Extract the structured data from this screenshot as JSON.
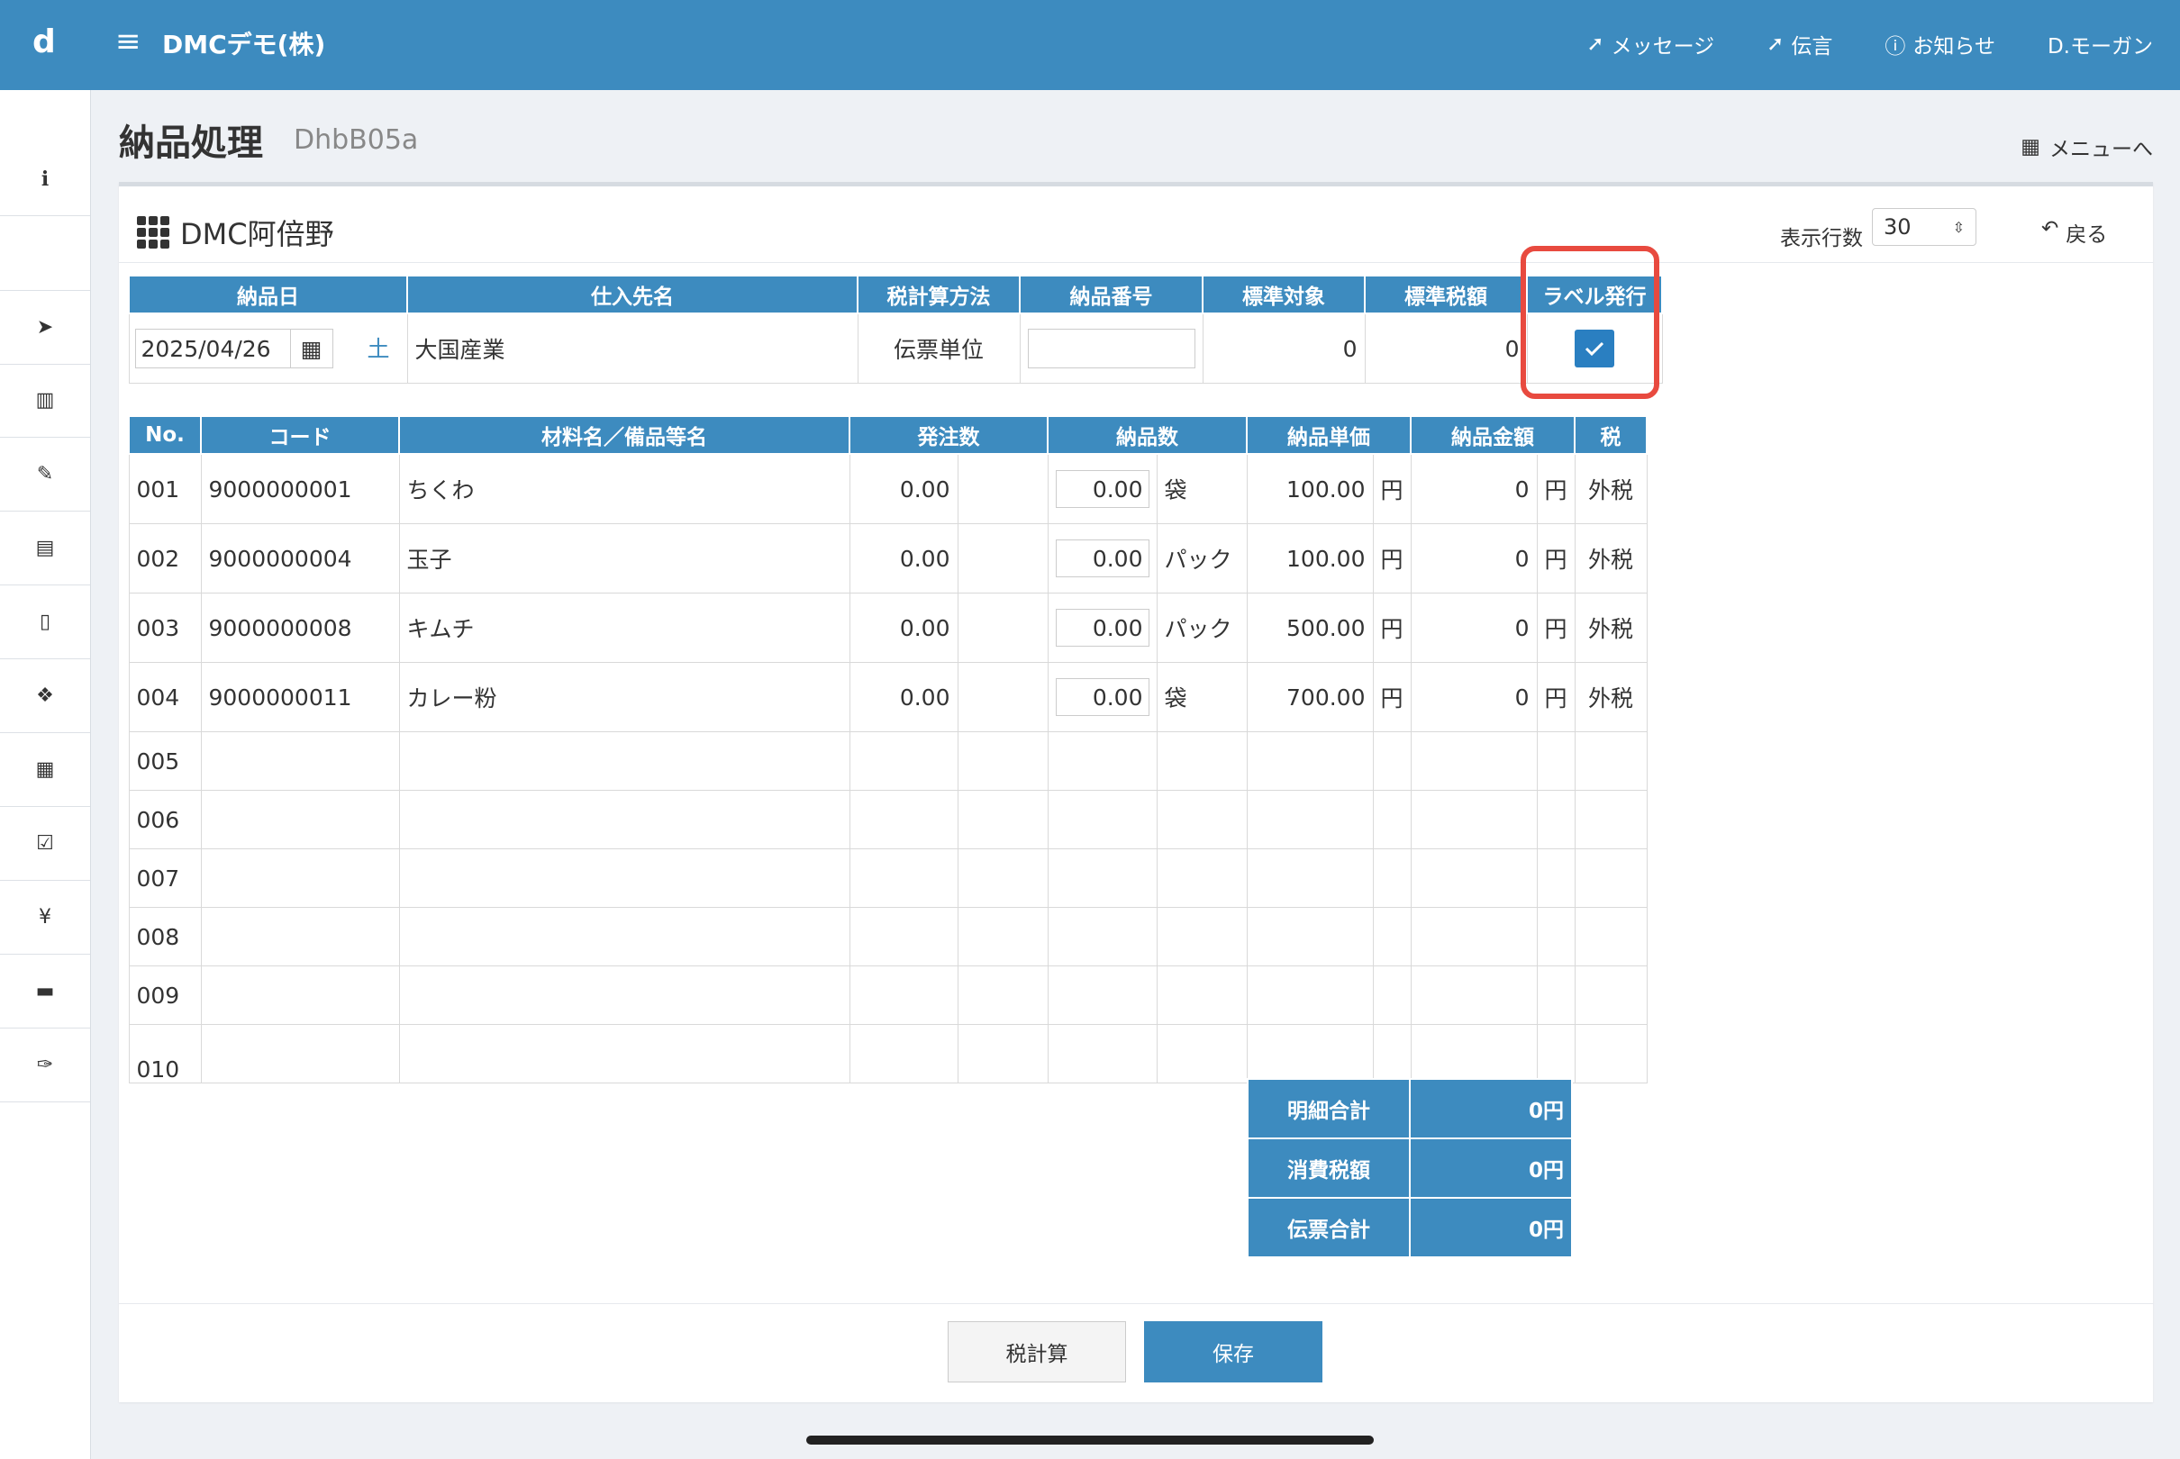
{
  "app": {
    "logo": "d",
    "company": "DMCデモ(株)",
    "nav": [
      "メッセージ",
      "伝言",
      "お知らせ",
      "D.モーガン"
    ]
  },
  "page": {
    "title": "納品処理",
    "code": "DhbB05a",
    "menu_link": "メニューへ"
  },
  "panel": {
    "title": "DMC阿倍野",
    "rows_label": "表示行数",
    "rows_value": "30",
    "back": "戻る"
  },
  "header_table": {
    "columns": [
      "納品日",
      "仕入先名",
      "税計算方法",
      "納品番号",
      "標準対象",
      "標準税額",
      "ラベル発行"
    ],
    "date": "2025/04/26",
    "weekday": "土",
    "supplier": "大国産業",
    "tax_method": "伝票単位",
    "slip_no": "",
    "std_target": "0",
    "std_tax": "0",
    "label_issue_checked": true
  },
  "detail_table": {
    "columns": [
      "No.",
      "コード",
      "材料名／備品等名",
      "発注数",
      "納品数",
      "納品単価",
      "納品金額",
      "税"
    ],
    "rows": [
      {
        "no": "001",
        "code": "9000000001",
        "name": "ちくわ",
        "order_qty": "0.00",
        "delivery_qty": "0.00",
        "unit": "袋",
        "unit_price": "100.00",
        "yen1": "円",
        "amount": "0",
        "yen2": "円",
        "tax": "外税"
      },
      {
        "no": "002",
        "code": "9000000004",
        "name": "玉子",
        "order_qty": "0.00",
        "delivery_qty": "0.00",
        "unit": "パック",
        "unit_price": "100.00",
        "yen1": "円",
        "amount": "0",
        "yen2": "円",
        "tax": "外税"
      },
      {
        "no": "003",
        "code": "9000000008",
        "name": "キムチ",
        "order_qty": "0.00",
        "delivery_qty": "0.00",
        "unit": "パック",
        "unit_price": "500.00",
        "yen1": "円",
        "amount": "0",
        "yen2": "円",
        "tax": "外税"
      },
      {
        "no": "004",
        "code": "9000000011",
        "name": "カレー粉",
        "order_qty": "0.00",
        "delivery_qty": "0.00",
        "unit": "袋",
        "unit_price": "700.00",
        "yen1": "円",
        "amount": "0",
        "yen2": "円",
        "tax": "外税"
      }
    ],
    "empty_rows": [
      "005",
      "006",
      "007",
      "008",
      "009",
      "010"
    ]
  },
  "totals": [
    {
      "label": "明細合計",
      "value": "0円"
    },
    {
      "label": "消費税額",
      "value": "0円"
    },
    {
      "label": "伝票合計",
      "value": "0円"
    }
  ],
  "buttons": {
    "tax_calc": "税計算",
    "save": "保存"
  },
  "sidebar_icons": [
    "info-icon",
    "send-icon",
    "bar-chart-icon",
    "edit-icon",
    "fax-icon",
    "document-icon",
    "cubes-icon",
    "calendar-icon",
    "calendar-check-icon",
    "yen-icon",
    "briefcase-icon",
    "wrench-icon"
  ],
  "colors": {
    "primary": "#3d8bbf",
    "checkbox": "#2a7fc1",
    "highlight": "#e84a3f"
  }
}
